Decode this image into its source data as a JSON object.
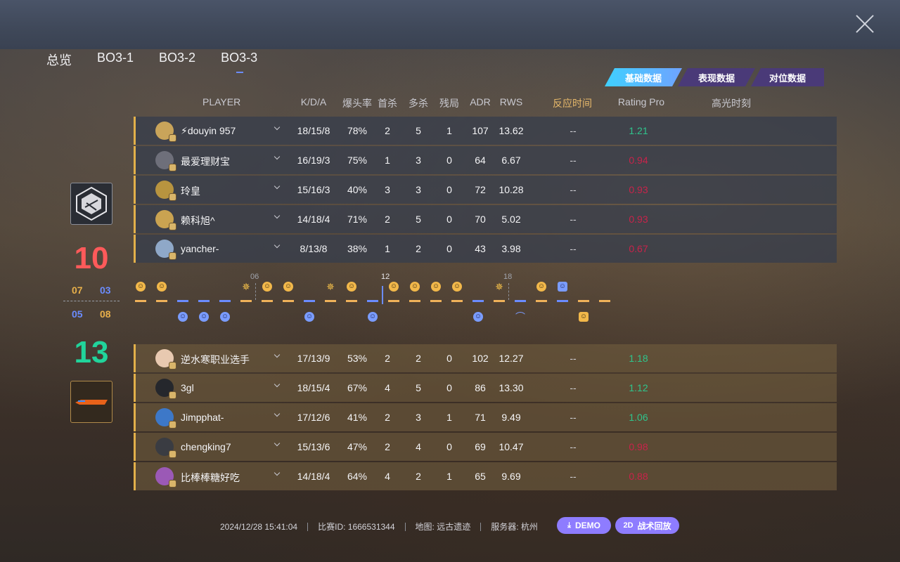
{
  "tabs": [
    "总览",
    "BO3-1",
    "BO3-2",
    "BO3-3"
  ],
  "segment_tabs": [
    "基础数据",
    "表现数据",
    "对位数据"
  ],
  "columns": {
    "player": "PLAYER",
    "kda": "K/D/A",
    "hs": "爆头率",
    "first_kill": "首杀",
    "multi_kill": "多杀",
    "clutch": "残局",
    "adr": "ADR",
    "rws": "RWS",
    "reaction": "反应时间",
    "rating": "Rating Pro",
    "highlight": "高光时刻"
  },
  "team_a": {
    "score": "10",
    "half1": "07",
    "half2": "03",
    "accent": "#ff5a5a",
    "players": [
      {
        "name": "⚡douyin 957",
        "kda": "18/15/8",
        "hs": "78%",
        "fk": "2",
        "mk": "5",
        "cl": "1",
        "adr": "107",
        "rws": "13.62",
        "rt": "--",
        "rating": "1.21",
        "rating_class": "pos"
      },
      {
        "name": "最爱理财宝",
        "kda": "16/19/3",
        "hs": "75%",
        "fk": "1",
        "mk": "3",
        "cl": "0",
        "adr": "64",
        "rws": "6.67",
        "rt": "--",
        "rating": "0.94",
        "rating_class": "neg"
      },
      {
        "name": "玲皇",
        "kda": "15/16/3",
        "hs": "40%",
        "fk": "3",
        "mk": "3",
        "cl": "0",
        "adr": "72",
        "rws": "10.28",
        "rt": "--",
        "rating": "0.93",
        "rating_class": "neg"
      },
      {
        "name": "赖科旭^",
        "kda": "14/18/4",
        "hs": "71%",
        "fk": "2",
        "mk": "5",
        "cl": "0",
        "adr": "70",
        "rws": "5.02",
        "rt": "--",
        "rating": "0.93",
        "rating_class": "neg"
      },
      {
        "name": "yancher-",
        "kda": "8/13/8",
        "hs": "38%",
        "fk": "1",
        "mk": "2",
        "cl": "0",
        "adr": "43",
        "rws": "3.98",
        "rt": "--",
        "rating": "0.67",
        "rating_class": "neg"
      }
    ]
  },
  "team_b": {
    "score": "13",
    "half1": "05",
    "half2": "08",
    "accent": "#21d49b",
    "players": [
      {
        "name": "逆水寒职业选手",
        "kda": "17/13/9",
        "hs": "53%",
        "fk": "2",
        "mk": "2",
        "cl": "0",
        "adr": "102",
        "rws": "12.27",
        "rt": "--",
        "rating": "1.18",
        "rating_class": "pos"
      },
      {
        "name": "3gl",
        "kda": "18/15/4",
        "hs": "67%",
        "fk": "4",
        "mk": "5",
        "cl": "0",
        "adr": "86",
        "rws": "13.30",
        "rt": "--",
        "rating": "1.12",
        "rating_class": "pos"
      },
      {
        "name": "Jimpphat-",
        "kda": "17/12/6",
        "hs": "41%",
        "fk": "2",
        "mk": "3",
        "cl": "1",
        "adr": "71",
        "rws": "9.49",
        "rt": "--",
        "rating": "1.06",
        "rating_class": "pos"
      },
      {
        "name": "chengking7",
        "kda": "15/13/6",
        "hs": "47%",
        "fk": "2",
        "mk": "4",
        "cl": "0",
        "adr": "69",
        "rws": "10.47",
        "rt": "--",
        "rating": "0.98",
        "rating_class": "neg"
      },
      {
        "name": "比棒棒糖好吃",
        "kda": "14/18/4",
        "hs": "64%",
        "fk": "4",
        "mk": "2",
        "cl": "1",
        "adr": "65",
        "rws": "9.69",
        "rt": "--",
        "rating": "0.88",
        "rating_class": "neg"
      }
    ]
  },
  "timeline": {
    "marks": [
      "06",
      "12",
      "18"
    ],
    "rounds": [
      {
        "side": "o",
        "icon": "smile"
      },
      {
        "side": "o",
        "icon": "smile"
      },
      {
        "side": "b",
        "icon": "smile"
      },
      {
        "side": "b",
        "icon": "smile"
      },
      {
        "side": "b",
        "icon": "smile"
      },
      {
        "side": "o",
        "icon": "star"
      },
      {
        "side": "o",
        "icon": "smile"
      },
      {
        "side": "o",
        "icon": "smile"
      },
      {
        "side": "b",
        "icon": "smile"
      },
      {
        "side": "o",
        "icon": "star"
      },
      {
        "side": "o",
        "icon": "smile"
      },
      {
        "side": "b",
        "icon": "smile"
      },
      {
        "side": "o",
        "icon": "smile"
      },
      {
        "side": "o",
        "icon": "smile"
      },
      {
        "side": "o",
        "icon": "smile"
      },
      {
        "side": "o",
        "icon": "smile"
      },
      {
        "side": "b",
        "icon": "smile"
      },
      {
        "side": "o",
        "icon": "star"
      },
      {
        "side": "b",
        "icon": "knife"
      },
      {
        "side": "o",
        "icon": "smile"
      },
      {
        "side": "b",
        "icon": "square"
      },
      {
        "side": "o",
        "icon": "square"
      },
      {
        "side": "o",
        "icon": "none"
      }
    ]
  },
  "footer": {
    "datetime": "2024/12/28 15:41:04",
    "match_id": "比赛ID: 1666531344",
    "map": "地图: 远古遗迹",
    "server": "服务器: 杭州",
    "demo_label": "DEMO",
    "replay_label": "战术回放",
    "replay_prefix": "2D"
  }
}
